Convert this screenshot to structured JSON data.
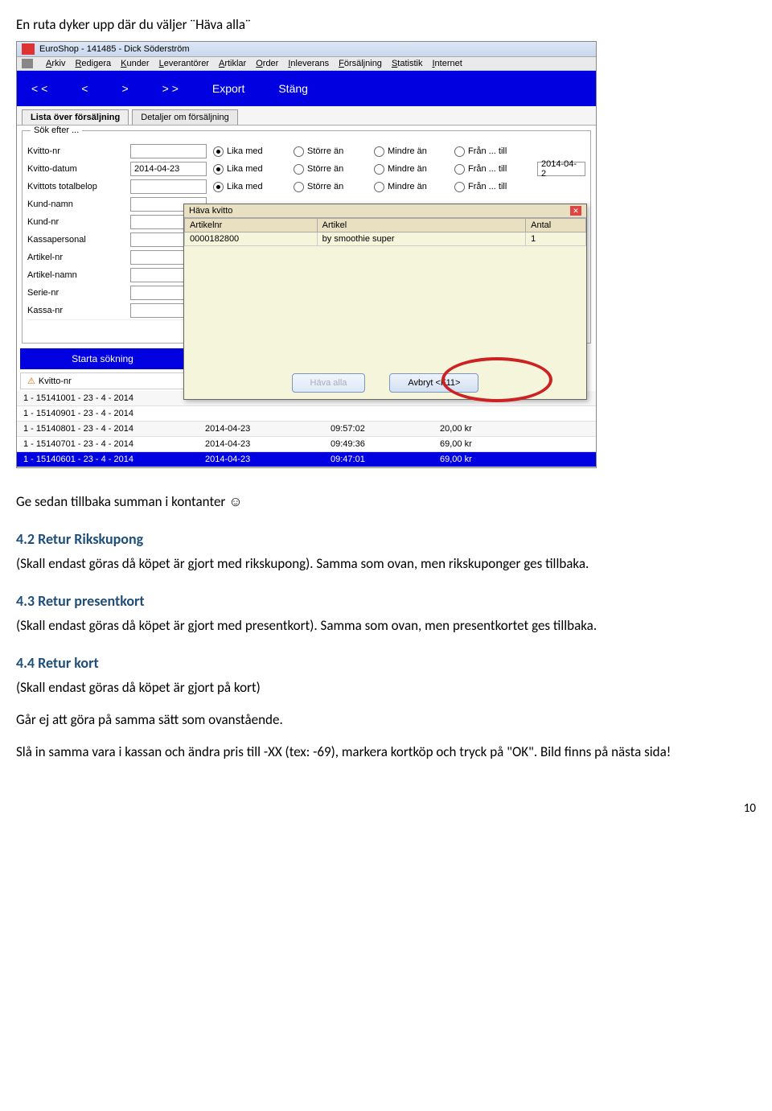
{
  "intro": "En ruta dyker upp där du väljer ¨Häva alla¨",
  "window": {
    "title": "EuroShop - 141485 - Dick Söderström"
  },
  "menu": {
    "items": [
      "Arkiv",
      "Redigera",
      "Kunder",
      "Leverantörer",
      "Artiklar",
      "Order",
      "Inleverans",
      "Försäljning",
      "Statistik",
      "Internet"
    ]
  },
  "toolbar": {
    "prev2": "< <",
    "prev": "<",
    "next": ">",
    "next2": "> >",
    "export": "Export",
    "close": "Stäng"
  },
  "tabs": {
    "list": "Lista över försäljning",
    "details": "Detaljer om försäljning"
  },
  "search": {
    "group_label": "Sök efter ...",
    "radios": [
      "Lika med",
      "Större än",
      "Mindre än",
      "Från ... till"
    ],
    "rows": [
      {
        "label": "Kvitto-nr",
        "value": "",
        "radios": true,
        "selected": 0
      },
      {
        "label": "Kvitto-datum",
        "value": "2014-04-23",
        "radios": true,
        "selected": 0,
        "extra": "2014-04-2"
      },
      {
        "label": "Kvittots totalbelop",
        "value": "",
        "radios": true,
        "selected": 0
      },
      {
        "label": "Kund-namn",
        "value": "",
        "radios": false
      },
      {
        "label": "Kund-nr",
        "value": "",
        "radios": false
      },
      {
        "label": "Kassapersonal",
        "value": "",
        "radios": false
      },
      {
        "label": "Artikel-nr",
        "value": "",
        "radios": false
      },
      {
        "label": "Artikel-namn",
        "value": "",
        "radios": false
      },
      {
        "label": "Serie-nr",
        "value": "",
        "radios": false
      },
      {
        "label": "Kassa-nr",
        "value": "",
        "radios": false
      }
    ]
  },
  "modal": {
    "title": "Häva kvitto",
    "cols": [
      "Artikelnr",
      "Artikel",
      "Antal"
    ],
    "row": {
      "artnr": "0000182800",
      "artikel": "by smoothie super",
      "antal": "1"
    },
    "hava": "Häva alla",
    "avbryt": "Avbryt <F11>"
  },
  "start_search": "Starta sökning",
  "results": {
    "header": "Kvitto-nr",
    "rows": [
      {
        "c1": "1 - 15141001 - 23 - 4 - 2014",
        "c2": "",
        "c3": "",
        "c4": ""
      },
      {
        "c1": "1 - 15140901 - 23 - 4 - 2014",
        "c2": "",
        "c3": "",
        "c4": ""
      },
      {
        "c1": "1 - 15140801 - 23 - 4 - 2014",
        "c2": "2014-04-23",
        "c3": "09:57:02",
        "c4": "20,00 kr"
      },
      {
        "c1": "1 - 15140701 - 23 - 4 - 2014",
        "c2": "2014-04-23",
        "c3": "09:49:36",
        "c4": "69,00 kr"
      },
      {
        "c1": "1 - 15140601 - 23 - 4 - 2014",
        "c2": "2014-04-23",
        "c3": "09:47:01",
        "c4": "69,00 kr",
        "sel": true
      }
    ]
  },
  "doc": {
    "after": "Ge sedan tillbaka summan i kontanter ☺",
    "h_42": "4.2 Retur Rikskupong",
    "p_42": "(Skall endast göras då köpet är gjort med rikskupong). Samma som ovan, men rikskuponger ges tillbaka.",
    "h_43": "4.3 Retur presentkort",
    "p_43": "(Skall endast göras då köpet är gjort med presentkort). Samma som ovan, men presentkortet ges tillbaka.",
    "h_44": "4.4 Retur kort",
    "p_44a": "(Skall endast göras då köpet är gjort på kort)",
    "p_44b": "Går ej att göra på samma sätt som ovanstående.",
    "p_44c": "Slå in samma vara i kassan och ändra pris till -XX (tex: -69), markera kortköp och tryck på \"OK\". Bild finns på nästa sida!"
  },
  "page_number": "10"
}
